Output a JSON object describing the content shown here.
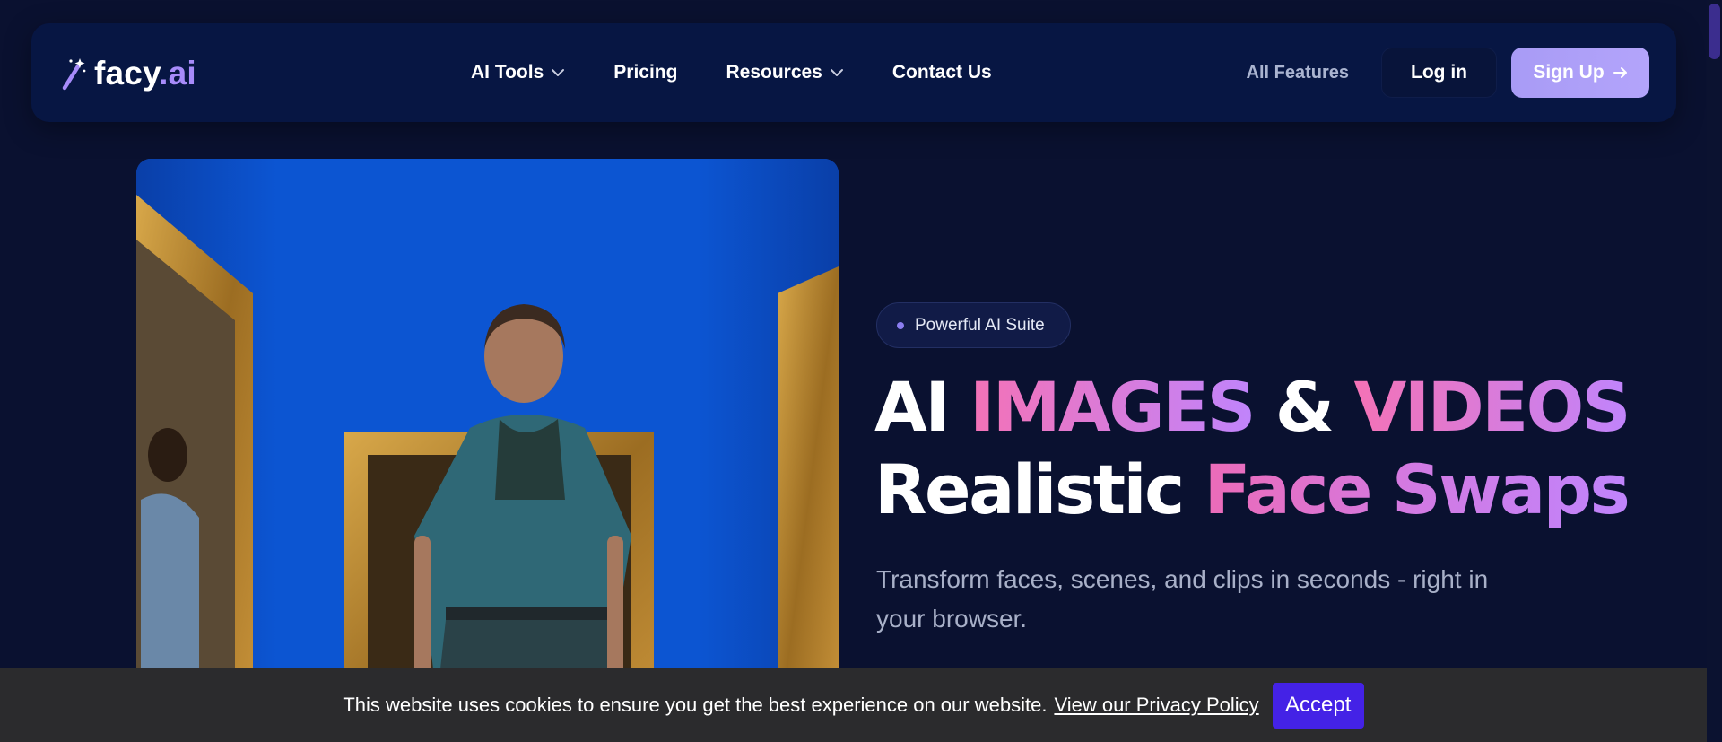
{
  "brand": {
    "logo_name": "facy",
    "logo_tld": ".ai",
    "logo_icon": "magic-wand-icon"
  },
  "nav": {
    "items": [
      {
        "label": "AI Tools",
        "has_dropdown": true
      },
      {
        "label": "Pricing",
        "has_dropdown": false
      },
      {
        "label": "Resources",
        "has_dropdown": true
      },
      {
        "label": "Contact Us",
        "has_dropdown": false
      }
    ],
    "all_features": "All Features",
    "login": "Log in",
    "signup": "Sign Up"
  },
  "hero": {
    "badge": "Powerful AI Suite",
    "headline": {
      "line1": [
        {
          "text": "AI ",
          "style": "white"
        },
        {
          "text": "IMAGES",
          "style": "gradient"
        },
        {
          "text": " & ",
          "style": "white"
        },
        {
          "text": "VIDEOS",
          "style": "gradient"
        }
      ],
      "line2": [
        {
          "text": "Realistic ",
          "style": "white"
        },
        {
          "text": "Face Swaps",
          "style": "gradient"
        }
      ]
    },
    "subtitle": "Transform faces, scenes, and clips in seconds - right in your browser."
  },
  "cookie": {
    "message": "This website uses cookies to ensure you get the best experience on our website.",
    "link": "View our Privacy Policy",
    "accept": "Accept"
  },
  "colors": {
    "background": "#0a1130",
    "navbar": "#071643",
    "accent_purple": "#a78bfa",
    "gradient_pink": "#f472b6",
    "gradient_violet": "#c084fc",
    "accept_button": "#4422e6",
    "cookie_bar": "#2b2b2d"
  }
}
